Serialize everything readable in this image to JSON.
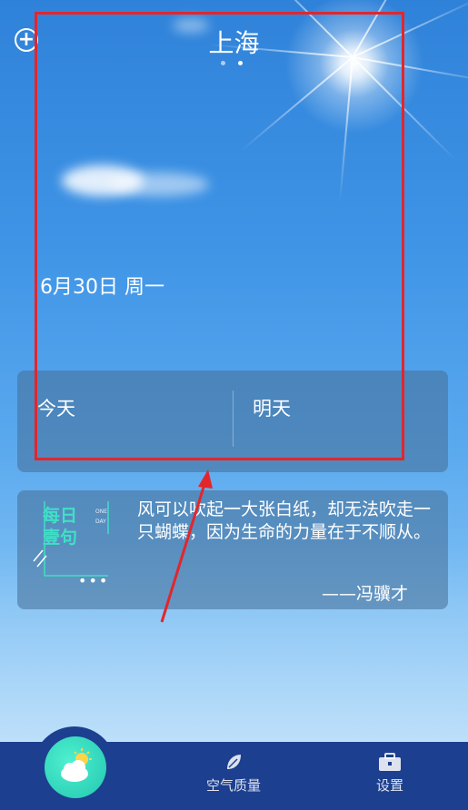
{
  "header": {
    "city": "上海",
    "add_icon": "plus-circle-icon",
    "page_dots": 2,
    "active_dot": 1
  },
  "date_text": "6月30日 周一",
  "forecast": {
    "today_label": "今天",
    "tomorrow_label": "明天"
  },
  "quote": {
    "badge_line1": "每日",
    "badge_line2": "壹句",
    "badge_small_line1": "ONE",
    "badge_small_line2": "DAY",
    "text": "风可以吹起一大张白纸，却无法吹走一只蝴蝶，因为生命的力量在于不顺从。",
    "author": "——冯骥才",
    "more": "•••"
  },
  "nav": {
    "home_icon": "cloud-sun-icon",
    "air_label": "空气质量",
    "air_icon": "leaf-icon",
    "settings_label": "设置",
    "settings_icon": "toolbox-icon"
  },
  "colors": {
    "nav_bg": "#1c3f8f",
    "accent": "#3fe0c6",
    "highlight": "#e2262c"
  }
}
